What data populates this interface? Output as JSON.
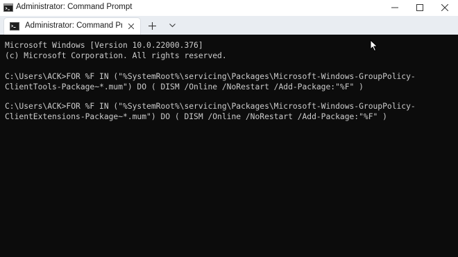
{
  "window": {
    "title": "Administrator: Command Prompt",
    "icons": {
      "app": "cmd-icon",
      "minimize": "minimize-icon",
      "maximize": "maximize-icon",
      "close": "close-icon"
    }
  },
  "tabs": [
    {
      "label": "Administrator: Command Prompt",
      "icon": "cmd-icon",
      "active": true
    }
  ],
  "tabbar": {
    "new_tab_icon": "plus-icon",
    "dropdown_icon": "chevron-down-icon",
    "close_icon": "close-icon"
  },
  "terminal": {
    "lines": [
      "Microsoft Windows [Version 10.0.22000.376]",
      "(c) Microsoft Corporation. All rights reserved.",
      "",
      "C:\\Users\\ACK>FOR %F IN (\"%SystemRoot%\\servicing\\Packages\\Microsoft-Windows-GroupPolicy-",
      "ClientTools-Package~*.mum\") DO ( DISM /Online /NoRestart /Add-Package:\"%F\" )",
      "",
      "C:\\Users\\ACK>FOR %F IN (\"%SystemRoot%\\servicing\\Packages\\Microsoft-Windows-GroupPolicy-",
      "ClientExtensions-Package~*.mum\") DO ( DISM /Online /NoRestart /Add-Package:\"%F\" )"
    ]
  },
  "colors": {
    "terminal_bg": "#0c0c0c",
    "terminal_fg": "#cccccc",
    "titlebar_bg": "#ffffff",
    "tabstrip_bg": "#e9edf2"
  }
}
